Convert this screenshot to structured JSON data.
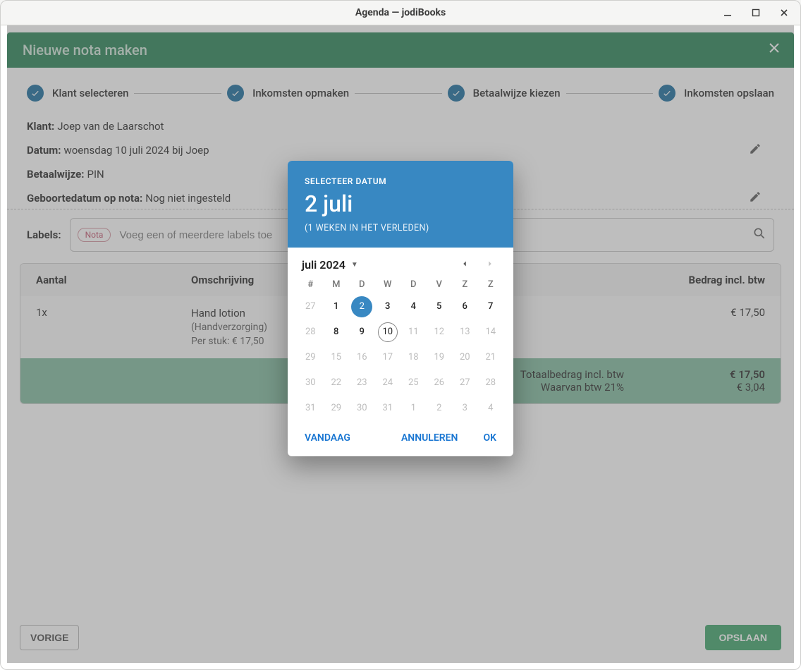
{
  "window": {
    "title": "Agenda — jodiBooks"
  },
  "header": {
    "title": "Nieuwe nota maken"
  },
  "steps": {
    "s1": "Klant selecteren",
    "s2": "Inkomsten opmaken",
    "s3": "Betaalwijze kiezen",
    "s4": "Inkomsten opslaan"
  },
  "details": {
    "klant_label": "Klant:",
    "klant_value": "Joep van de Laarschot",
    "datum_label": "Datum:",
    "datum_value": "woensdag 10 juli 2024 bij Joep",
    "betaal_label": "Betaalwijze:",
    "betaal_value": "PIN",
    "geb_label": "Geboortedatum op nota:",
    "geb_value": "Nog niet ingesteld"
  },
  "labels": {
    "label": "Labels:",
    "chip": "Nota",
    "placeholder": "Voeg een of meerdere labels toe"
  },
  "table": {
    "col_aantal": "Aantal",
    "col_omschr": "Omschrijving",
    "col_bedrag": "Bedrag incl. btw",
    "row1_qty": "1x",
    "row1_desc": "Hand lotion",
    "row1_sub1": "(Handverzorging)",
    "row1_sub2": "Per stuk: € 17,50",
    "row1_amount": "€ 17,50",
    "total_label_main": "Totaalbedrag incl. btw",
    "total_label_sub": "Waarvan btw 21%",
    "total_val_main": "€ 17,50",
    "total_val_sub": "€ 3,04"
  },
  "buttons": {
    "prev": "VORIGE",
    "save": "OPSLAAN"
  },
  "datepicker": {
    "label": "SELECTEER DATUM",
    "display": "2 juli",
    "note": "(1 WEKEN IN HET VERLEDEN)",
    "month": "juli 2024",
    "wd": {
      "wk": "#",
      "mo": "M",
      "tu": "D",
      "we": "W",
      "th": "D",
      "fr": "V",
      "sa": "Z",
      "su": "Z"
    },
    "selected_day": "2",
    "today_day": "10",
    "weeks": [
      {
        "wk": "27",
        "d": [
          "1",
          "2",
          "3",
          "4",
          "5",
          "6",
          "7"
        ],
        "flags": [
          "in",
          "sel",
          "in",
          "in",
          "in",
          "in",
          "in"
        ]
      },
      {
        "wk": "28",
        "d": [
          "8",
          "9",
          "10",
          "11",
          "12",
          "13",
          "14"
        ],
        "flags": [
          "in",
          "in",
          "today",
          "out",
          "out",
          "out",
          "out"
        ]
      },
      {
        "wk": "29",
        "d": [
          "15",
          "16",
          "17",
          "18",
          "19",
          "20",
          "21"
        ],
        "flags": [
          "out",
          "out",
          "out",
          "out",
          "out",
          "out",
          "out"
        ]
      },
      {
        "wk": "30",
        "d": [
          "22",
          "23",
          "24",
          "25",
          "26",
          "27",
          "28"
        ],
        "flags": [
          "out",
          "out",
          "out",
          "out",
          "out",
          "out",
          "out"
        ]
      },
      {
        "wk": "31",
        "d": [
          "29",
          "30",
          "31",
          "1",
          "2",
          "3",
          "4"
        ],
        "flags": [
          "out",
          "out",
          "out",
          "out",
          "out",
          "out",
          "out"
        ]
      }
    ],
    "today_btn": "VANDAAG",
    "cancel_btn": "ANNULEREN",
    "ok_btn": "OK"
  }
}
